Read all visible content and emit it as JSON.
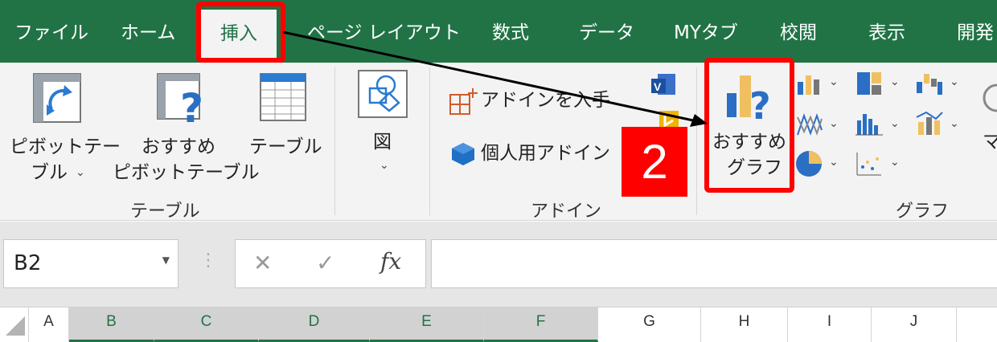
{
  "tabs": [
    "ファイル",
    "ホーム",
    "挿入",
    "ページ レイアウト",
    "数式",
    "データ",
    "MYタブ",
    "校閲",
    "表示",
    "開発"
  ],
  "ribbon": {
    "table_group": {
      "pivot_table_l1": "ピボットテー",
      "pivot_table_l2": "ブル",
      "recommended_pivot_l1": "おすすめ",
      "recommended_pivot_l2": "ピボットテーブル",
      "table": "テーブル",
      "group_label": "テーブル"
    },
    "illustrations": {
      "figure": "図"
    },
    "addins_group": {
      "get_addins": "アドインを入手",
      "my_addins": "個人用アドイン",
      "group_label": "アドイン"
    },
    "charts_group": {
      "recommended_l1": "おすすめ",
      "recommended_l2": "グラフ",
      "group_label": "グラフ"
    },
    "partial_label": "マ"
  },
  "annotation": {
    "step": "2"
  },
  "formula_bar": {
    "name_box": "B2",
    "cancel_symbol": "✕",
    "enter_symbol": "✓",
    "fx_symbol": "fx",
    "dots": "⋮"
  },
  "columns": [
    "A",
    "B",
    "C",
    "D",
    "E",
    "F",
    "G",
    "H",
    "I",
    "J"
  ],
  "colors": {
    "excel_green": "#217346",
    "highlight_red": "#ff0000"
  }
}
